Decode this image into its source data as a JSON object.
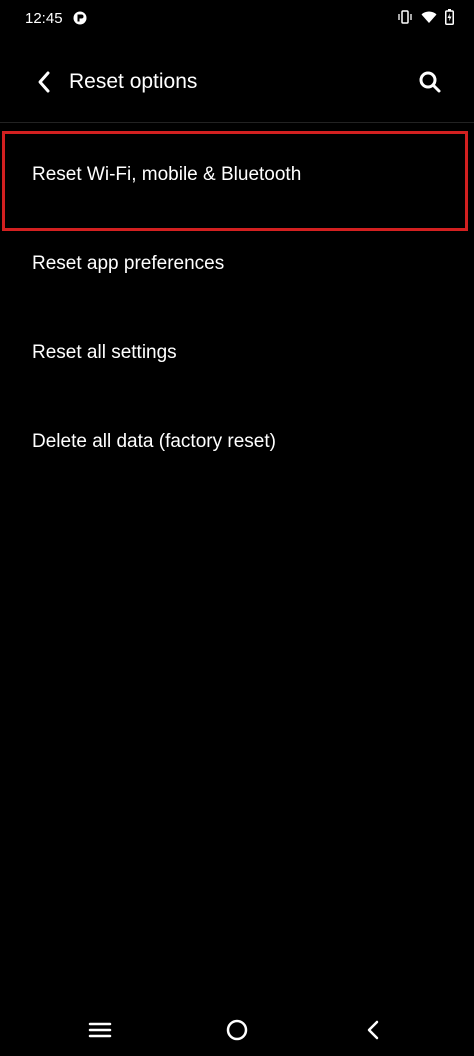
{
  "status_bar": {
    "time": "12:45",
    "icons": [
      "app-notification-icon",
      "vibrate-icon",
      "wifi-icon",
      "battery-icon"
    ]
  },
  "header": {
    "title": "Reset options",
    "back_icon": "chevron-left-icon",
    "search_icon": "search-icon"
  },
  "menu": {
    "items": [
      {
        "label": "Reset Wi-Fi, mobile & Bluetooth",
        "highlighted": true
      },
      {
        "label": "Reset app preferences"
      },
      {
        "label": "Reset all settings"
      },
      {
        "label": "Delete all data (factory reset)"
      }
    ]
  },
  "highlight_color": "#d32020",
  "nav_bar": {
    "icons": [
      "menu-icon",
      "home-icon",
      "back-icon"
    ]
  }
}
